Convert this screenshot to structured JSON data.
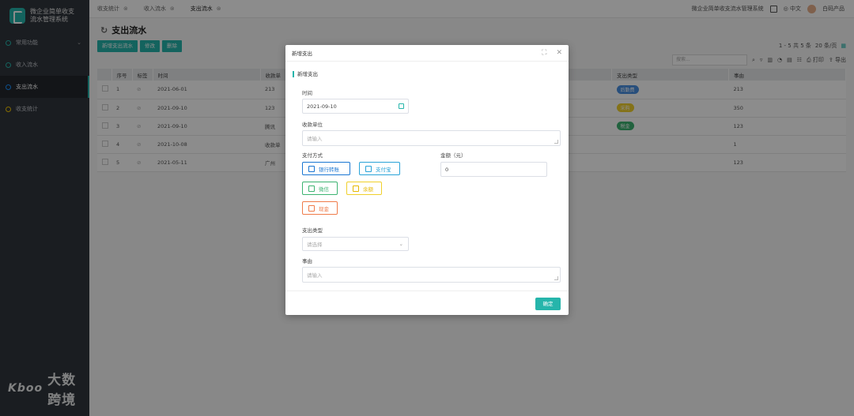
{
  "app": {
    "logo_line1": "微企业简单收支",
    "logo_line2": "流水管理系统"
  },
  "sidebar": {
    "items": [
      {
        "label": "常用功能"
      },
      {
        "label": "收入流水"
      },
      {
        "label": "支出流水"
      },
      {
        "label": "收支统计"
      }
    ]
  },
  "tabs": [
    {
      "label": "收支统计"
    },
    {
      "label": "收入流水"
    },
    {
      "label": "支出流水"
    }
  ],
  "topbar": {
    "system_name": "微企业简单收支流水管理系统",
    "lang": "中文",
    "user": "白码产品"
  },
  "page": {
    "title": "支出流水",
    "buttons": [
      "新增支出流水",
      "修改",
      "删除"
    ],
    "search_placeholder": "搜索...",
    "pagination": "1 - 5 共 5 条",
    "page_size": "20 条/页",
    "print": "打印",
    "export": "导出"
  },
  "table": {
    "headers": [
      "序号",
      "标签",
      "时间",
      "收款单",
      "支出类型",
      "事由"
    ],
    "rows": [
      {
        "no": "1",
        "time": "2021-06-01",
        "payee": "213",
        "type": "后勤费",
        "type_color": "#4a90e2",
        "reason": "213"
      },
      {
        "no": "2",
        "time": "2021-09-10",
        "payee": "123",
        "type": "采购",
        "type_color": "#f0d02c",
        "reason": "350"
      },
      {
        "no": "3",
        "time": "2021-09-10",
        "payee": "腾讯",
        "type": "税金",
        "type_color": "#3cb371",
        "reason": "123"
      },
      {
        "no": "4",
        "time": "2021-10-08",
        "payee": "收款单",
        "type": "",
        "type_color": "",
        "reason": "1"
      },
      {
        "no": "5",
        "time": "2021-05-11",
        "payee": "广州",
        "type": "",
        "type_color": "",
        "reason": "123"
      }
    ]
  },
  "modal": {
    "title": "新增支出",
    "section": "新增支出",
    "time_label": "时间",
    "time_value": "2021-09-10",
    "payee_label": "收款单位",
    "payee_placeholder": "请输入",
    "pay_method_label": "支付方式",
    "pay_methods": [
      "银行转账",
      "支付宝",
      "微信",
      "余额",
      "现金"
    ],
    "amount_label": "金额（元）",
    "amount_value": "0",
    "type_label": "支出类型",
    "type_placeholder": "请选择",
    "reason_label": "事由",
    "reason_placeholder": "请输入",
    "ok_label": "确定"
  },
  "watermark": {
    "mark": "Kboo",
    "text": "大数跨境"
  }
}
